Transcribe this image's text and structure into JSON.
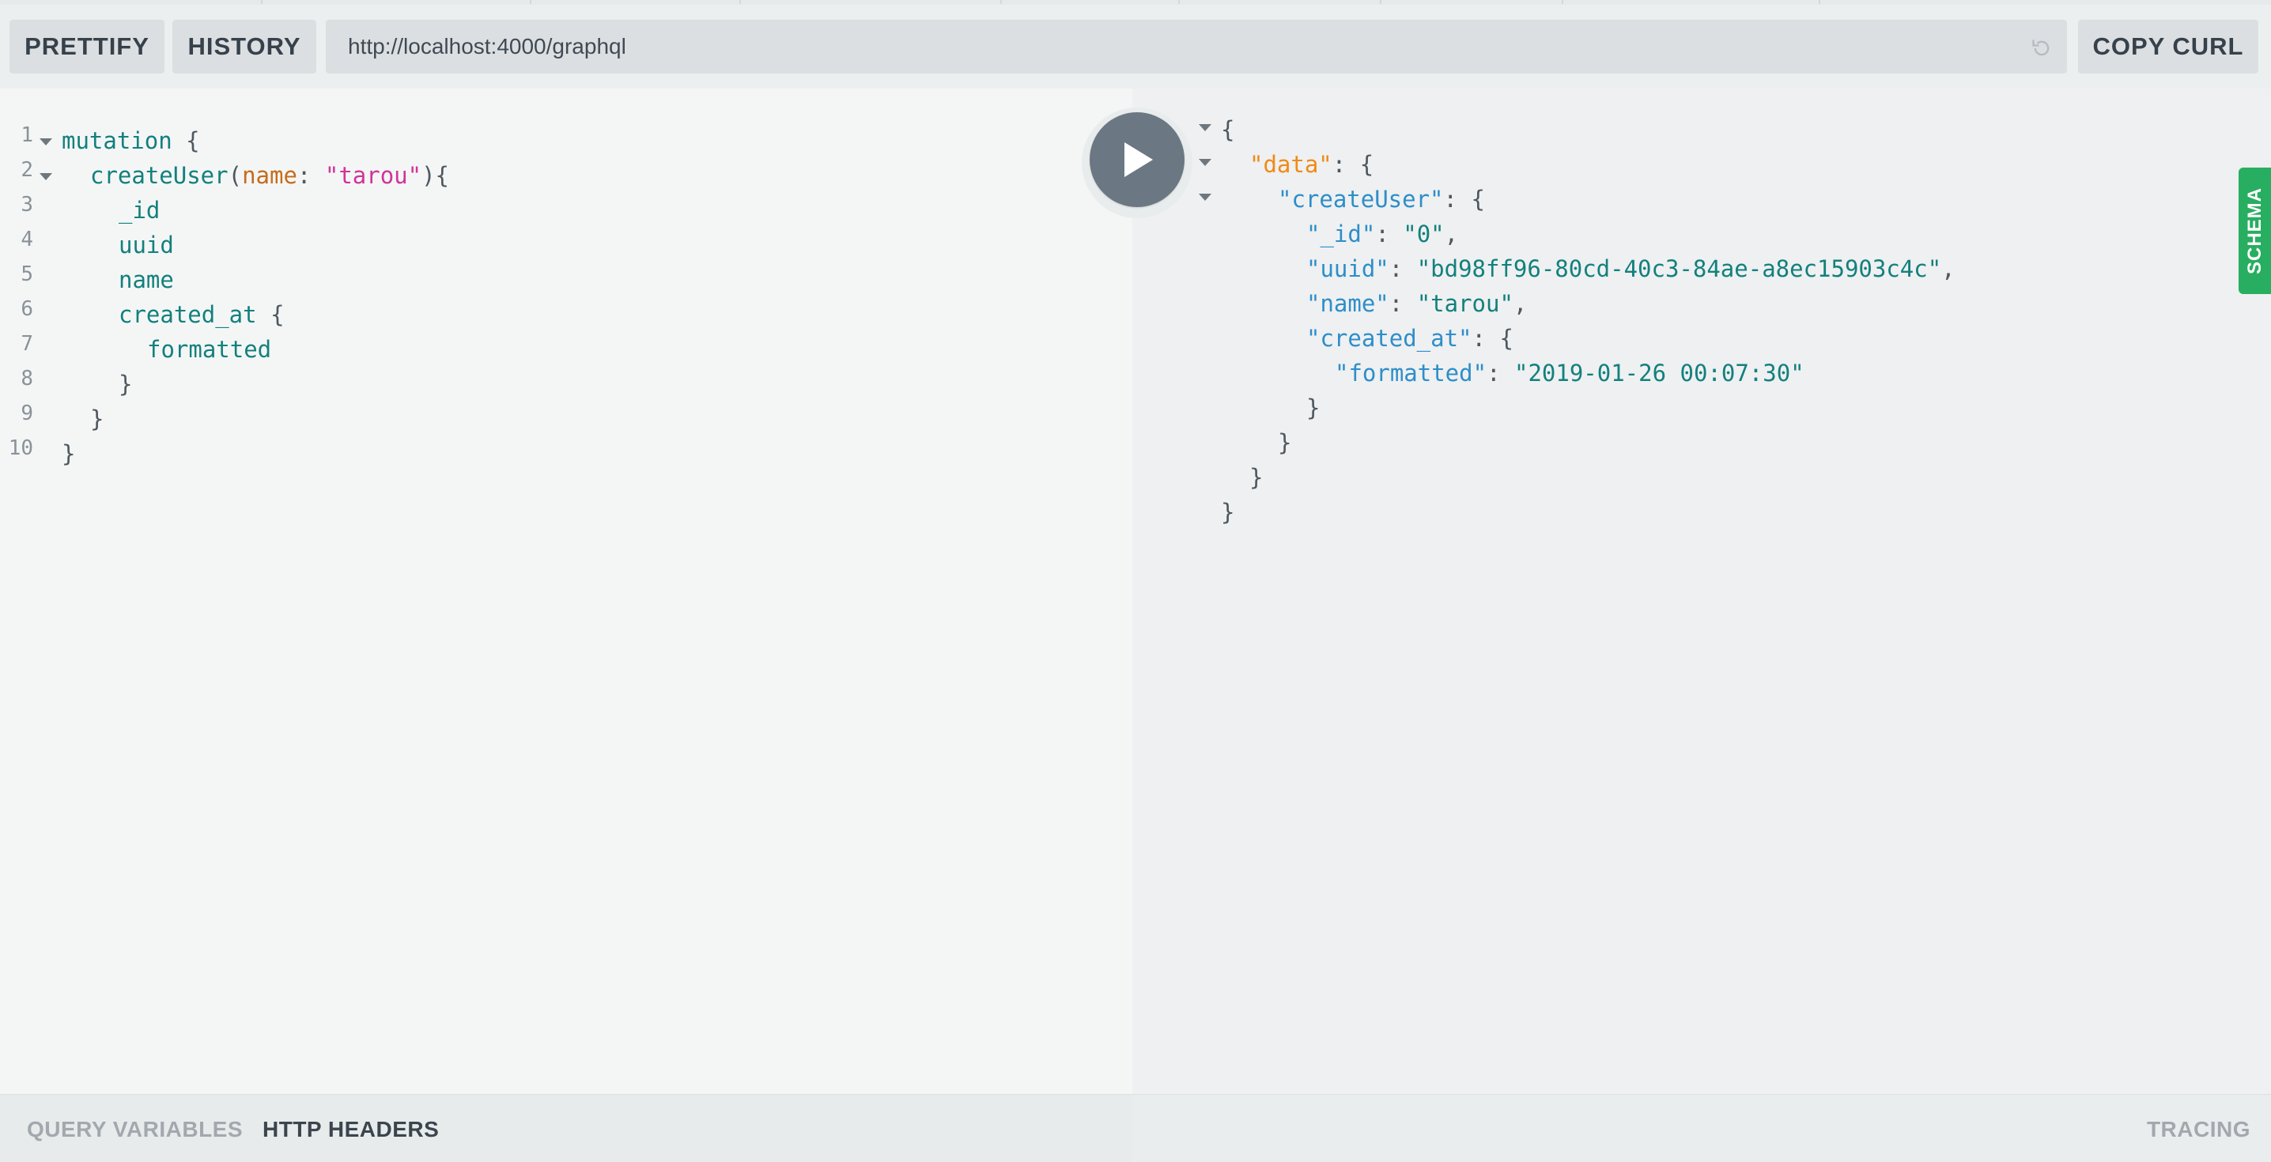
{
  "toolbar": {
    "prettify_label": "PRETTIFY",
    "history_label": "HISTORY",
    "endpoint_url": "http://localhost:4000/graphql",
    "copy_curl_label": "COPY CURL"
  },
  "editor": {
    "line_numbers": [
      "1",
      "2",
      "3",
      "4",
      "5",
      "6",
      "7",
      "8",
      "9",
      "10"
    ],
    "lines": {
      "l1_keyword": "mutation",
      "l1_brace": "{",
      "l2_field": "createUser",
      "l2_open": "(",
      "l2_arg": "name",
      "l2_colon": ":",
      "l2_value": "\"tarou\"",
      "l2_close": "){",
      "l3_field": "_id",
      "l4_field": "uuid",
      "l5_field": "name",
      "l6_field": "created_at",
      "l6_brace": "{",
      "l7_field": "formatted",
      "l8_brace": "}",
      "l9_brace": "}",
      "l10_brace": "}"
    }
  },
  "result": {
    "open_brace": "{",
    "data_key": "\"data\"",
    "create_user_key": "\"createUser\"",
    "id_key": "\"_id\"",
    "id_value": "\"0\"",
    "uuid_key": "\"uuid\"",
    "uuid_value": "\"bd98ff96-80cd-40c3-84ae-a8ec15903c4c\"",
    "name_key": "\"name\"",
    "name_value": "\"tarou\"",
    "created_at_key": "\"created_at\"",
    "formatted_key": "\"formatted\"",
    "formatted_value": "\"2019-01-26 00:07:30\"",
    "colon": ":",
    "comma": ",",
    "brace_open": "{",
    "brace_close": "}"
  },
  "schema_tab_label": "SCHEMA",
  "bottom": {
    "query_variables_label": "QUERY VARIABLES",
    "http_headers_label": "HTTP HEADERS",
    "tracing_label": "TRACING"
  },
  "colors": {
    "schema_tab": "#27ae60",
    "play_button": "#6b7883",
    "keyword": "#13807d",
    "argument": "#c66c1c",
    "string": "#d2339a",
    "result_data_key": "#f08a16",
    "result_key": "#2d8ec9"
  },
  "icons": {
    "play": "play-icon",
    "reload": "reload-icon",
    "fold": "fold-arrow-icon"
  }
}
